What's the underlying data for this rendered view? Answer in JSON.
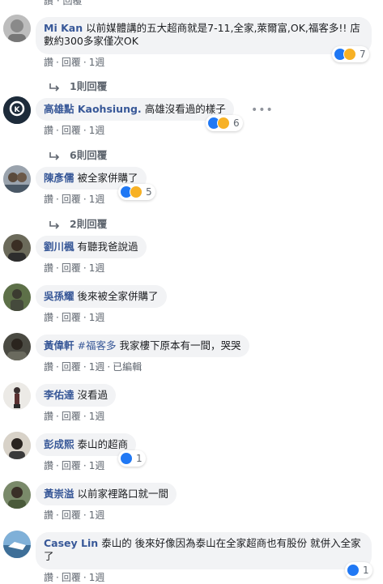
{
  "top": {
    "like": "讚",
    "reply": "回覆"
  },
  "comments": [
    {
      "author": "Mi Kan",
      "text": "以前媒體講的五大超商就是7-11,全家,萊爾富,OK,福客多!! 店數約300多家僅次OK",
      "like": "讚",
      "reply": "回覆",
      "time": "1週",
      "reactions": "7",
      "replies": "1則回覆"
    },
    {
      "author": "高雄點 Kaohsiung.",
      "text": "高雄沒看過的樣子",
      "like": "讚",
      "reply": "回覆",
      "time": "1週",
      "reactions": "6",
      "replies": "6則回覆"
    },
    {
      "author": "陳彥儒",
      "text": "被全家併購了",
      "like": "讚",
      "reply": "回覆",
      "time": "1週",
      "reactions": "5",
      "replies": "2則回覆"
    },
    {
      "author": "劉川楓",
      "text": "有聽我爸說過",
      "like": "讚",
      "reply": "回覆",
      "time": "1週"
    },
    {
      "author": "吳孫耀",
      "text": "後來被全家併購了",
      "like": "讚",
      "reply": "回覆",
      "time": "1週"
    },
    {
      "author": "黃偉軒",
      "tag": "#福客多",
      "text": "我家樓下原本有一間，哭哭",
      "like": "讚",
      "reply": "回覆",
      "time": "1週",
      "edited": "已編輯"
    },
    {
      "author": "李佑達",
      "text": "沒看過",
      "like": "讚",
      "reply": "回覆",
      "time": "1週"
    },
    {
      "author": "彭成熙",
      "text": "泰山的超商",
      "like": "讚",
      "reply": "回覆",
      "time": "1週",
      "reactions": "1"
    },
    {
      "author": "黃崇溢",
      "text": "以前家裡路口就一間",
      "like": "讚",
      "reply": "回覆",
      "time": "1週"
    },
    {
      "author": "Casey Lin",
      "text": "泰山的 後來好像因為泰山在全家超商也有股份 就併入全家了",
      "like": "讚",
      "reply": "回覆",
      "time": "1週",
      "reactions": "1"
    }
  ],
  "colors": {
    "link": "#385898",
    "bubble": "#f2f3f5",
    "like": "#2078f4",
    "haha": "#f7b125"
  }
}
